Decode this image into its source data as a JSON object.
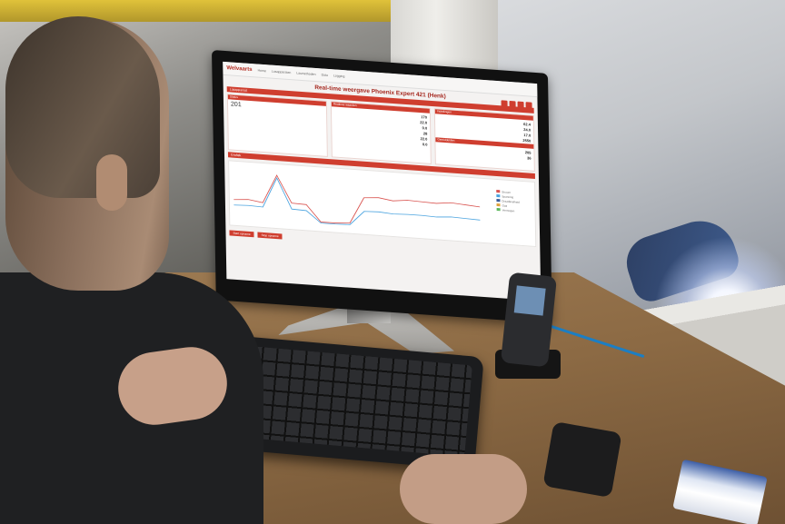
{
  "app": {
    "logo": "Welvaarts",
    "menu": [
      "Home",
      "Lasapparaten",
      "Lasmethoden",
      "Data",
      "Logging"
    ],
    "title": "Real-time weergave Phoenix Expert 421 (Henk)",
    "sections": {
      "top_bar": "Lasapparaat",
      "status": "Status",
      "realtime": "Realtime waarden",
      "instellingen": "Instellingen",
      "grafiek": "Grafiek",
      "extra": "Gemiddelden"
    },
    "values": {
      "left_big": "201",
      "middle": [
        "170",
        "22.0",
        "0.0",
        "28",
        "22.0",
        "0.0"
      ],
      "right": [
        "62.4",
        "24.0",
        "17.0",
        "2550"
      ],
      "right_lower": [
        "205",
        "36"
      ]
    },
    "legend": [
      "Stroom",
      "Spanning",
      "Draadsnelheid",
      "Gas",
      "Vermogen"
    ],
    "buttons": [
      "Start opname",
      "Stop opname"
    ],
    "colors": {
      "accent": "#cf3e2f",
      "series": [
        "#d9534f",
        "#4aa3df",
        "#3a5b9a",
        "#e0a23a",
        "#5cb85c"
      ]
    },
    "chart_data": {
      "type": "line",
      "series": [
        {
          "name": "Stroom",
          "values": [
            40,
            42,
            38,
            90,
            41,
            40,
            10,
            10,
            12,
            60,
            62,
            58,
            61,
            60,
            59,
            62,
            60,
            58
          ]
        },
        {
          "name": "Spanning",
          "values": [
            30,
            31,
            30,
            85,
            30,
            29,
            8,
            8,
            9,
            35,
            36,
            34,
            35,
            35,
            34,
            36,
            35,
            34
          ]
        }
      ],
      "x": [
        1,
        2,
        3,
        4,
        5,
        6,
        7,
        8,
        9,
        10,
        11,
        12,
        13,
        14,
        15,
        16,
        17,
        18
      ],
      "ylim": [
        0,
        100
      ]
    }
  }
}
